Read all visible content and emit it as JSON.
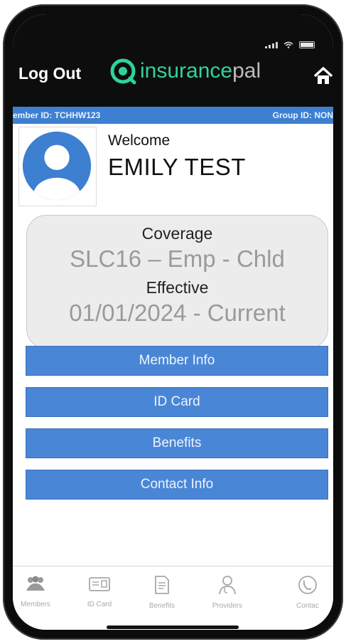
{
  "header": {
    "logout_label": "Log Out",
    "logo_part1": "insurance",
    "logo_part2": "pal"
  },
  "id_bar": {
    "member_id": "ember ID: TCHHW123",
    "group_id": "Group ID: NON"
  },
  "profile": {
    "welcome_label": "Welcome",
    "name": "EMILY TEST"
  },
  "coverage": {
    "coverage_label": "Coverage",
    "coverage_value": "SLC16 – Emp - Chld",
    "effective_label": "Effective",
    "effective_value": "01/01/2024  -  Current"
  },
  "menu": [
    {
      "label": "Member Info"
    },
    {
      "label": "ID Card"
    },
    {
      "label": "Benefits"
    },
    {
      "label": "Contact Info"
    }
  ],
  "tabbar": [
    {
      "label": "Members",
      "icon": "members-icon"
    },
    {
      "label": "ID Card",
      "icon": "id-card-icon"
    },
    {
      "label": "Benefits",
      "icon": "document-icon"
    },
    {
      "label": "Providers",
      "icon": "provider-icon"
    },
    {
      "label": "Contac",
      "icon": "phone-icon"
    }
  ],
  "colors": {
    "accent_blue": "#4a86d6",
    "id_bar_blue": "#3d7fd0",
    "logo_green": "#2fd39a"
  }
}
